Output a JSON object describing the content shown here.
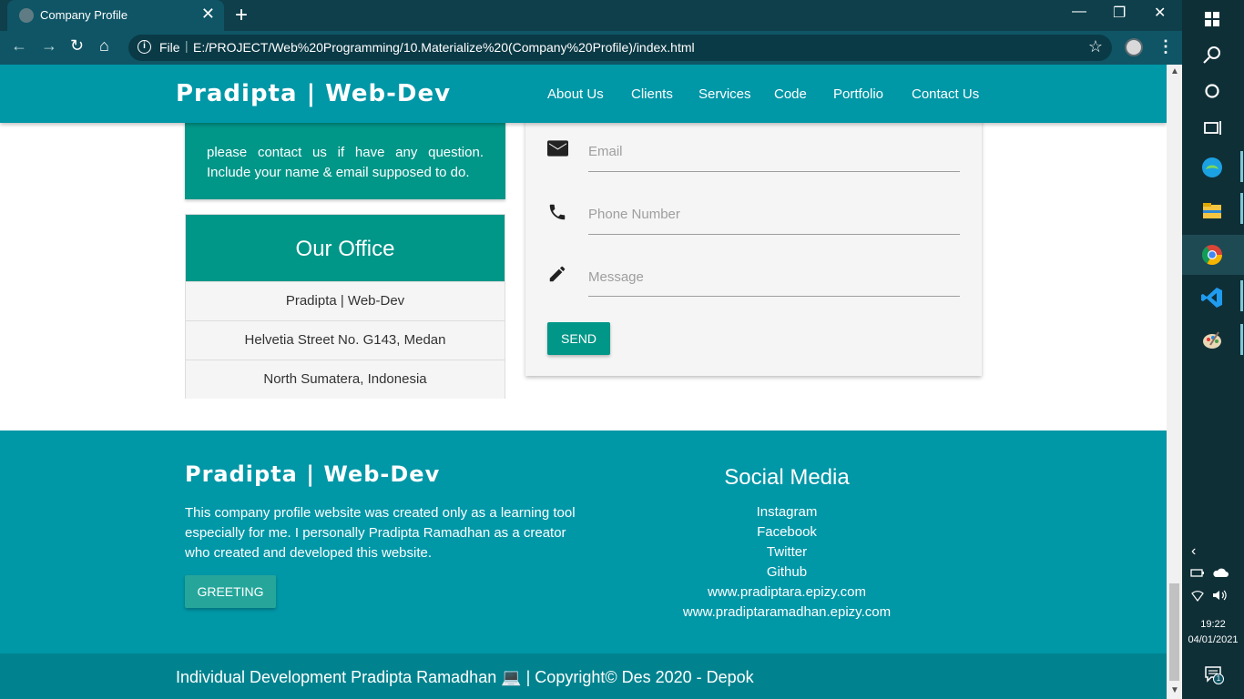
{
  "browser": {
    "tab_title": "Company Profile",
    "new_tab": "+",
    "tab_close": "✕",
    "scheme": "File",
    "url": "E:/PROJECT/Web%20Programming/10.Materialize%20(Company%20Profile)/index.html",
    "win_minimize": "—",
    "win_restore": "❐",
    "win_close": "✕"
  },
  "navbar": {
    "brand": "Pradipta | Web-Dev",
    "links": [
      "About Us",
      "Clients",
      "Services",
      "Code",
      "Portfolio",
      "Contact Us"
    ]
  },
  "contact": {
    "note": "please contact us if have any question. Include your name & email supposed to do."
  },
  "office": {
    "title": "Our Office",
    "rows": [
      "Pradipta | Web-Dev",
      "Helvetia Street No. G143, Medan",
      "North Sumatera, Indonesia"
    ]
  },
  "form": {
    "email_label": "Email",
    "phone_label": "Phone Number",
    "message_label": "Message",
    "send_label": "SEND",
    "icons": [
      "email-icon",
      "phone-icon",
      "pencil-icon"
    ]
  },
  "footer": {
    "brand": "Pradipta | Web-Dev",
    "description": "This company profile website was created only as a learning tool especially for me. I personally Pradipta Ramadhan as a creator who created and developed this website.",
    "greeting_label": "GREETING",
    "social_title": "Social Media",
    "social_links": [
      "Instagram",
      "Facebook",
      "Twitter",
      "Github",
      "www.pradiptara.epizy.com",
      "www.pradiptaramadhan.epizy.com"
    ],
    "copyright": "Individual Development Pradipta Ramadhan 💻 | Copyright© Des 2020 - Depok"
  },
  "taskbar": {
    "time": "19:22",
    "date": "04/01/2021",
    "notification_count": "1"
  },
  "colors": {
    "primary": "#0097a7",
    "teal": "#009688",
    "footer_bottom": "#00838f"
  }
}
